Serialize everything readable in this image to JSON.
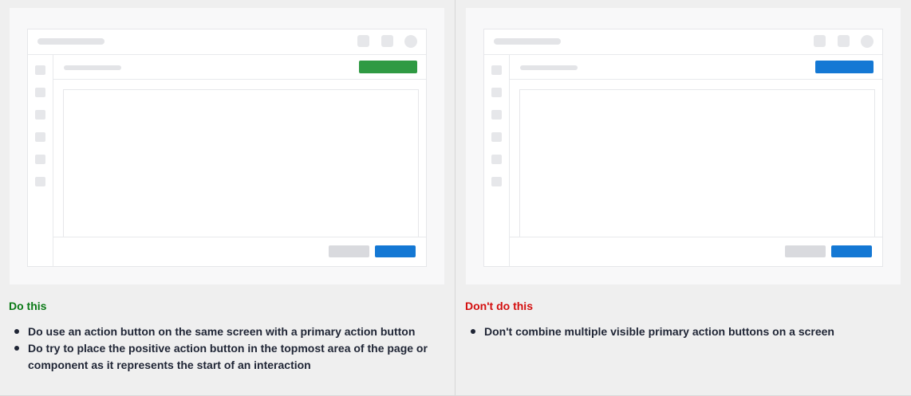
{
  "colors": {
    "do_heading": "#0a7a16",
    "dont_heading": "#d40e0e",
    "green_action": "#2f9a43",
    "blue_action": "#1478d4",
    "blue_primary": "#1478d4"
  },
  "do_panel": {
    "heading": "Do this",
    "bullets": [
      "Do use an action button on the same screen with a primary action button",
      "Do try to place the positive action button in the topmost area of the page or component as it represents the start of an interaction"
    ],
    "mockup": {
      "top_action_color": "green",
      "footer_primary_color": "blue"
    }
  },
  "dont_panel": {
    "heading": "Don't do this",
    "bullets": [
      "Don't combine multiple visible primary action buttons on a screen"
    ],
    "mockup": {
      "top_action_color": "blue",
      "footer_primary_color": "blue"
    }
  }
}
